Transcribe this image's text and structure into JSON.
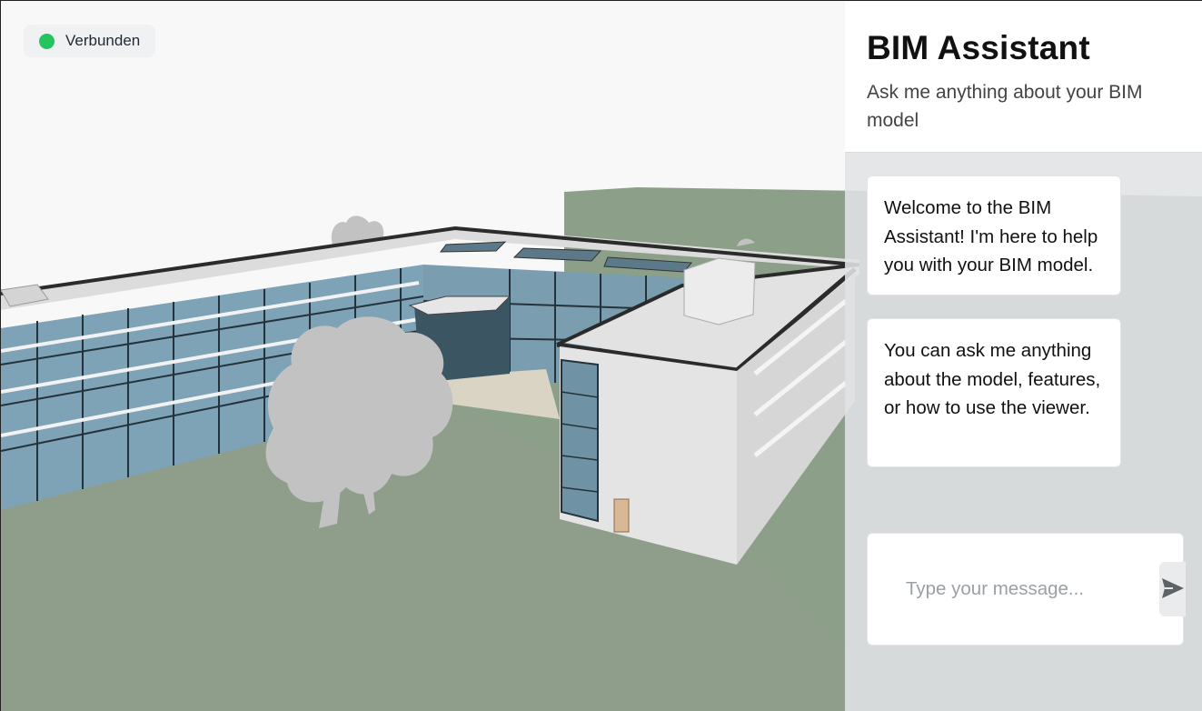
{
  "status": {
    "label": "Verbunden",
    "color": "#22c55e"
  },
  "panel": {
    "title": "BIM Assistant",
    "subtitle": "Ask me anything about your BIM model",
    "messages": [
      {
        "text": "Welcome to the BIM Assistant! I'm here to help you with your BIM model."
      },
      {
        "text": "You can ask me anything about the model, features, or how to use the viewer."
      }
    ],
    "input": {
      "placeholder": "Type your message...",
      "value": ""
    },
    "send_icon": "send-icon"
  },
  "colors": {
    "ground": "#8c9f88",
    "roof": "#e2e2e2",
    "glass": "#7ea2b6",
    "tree": "#c2c2c2",
    "accent": "#22c55e"
  }
}
